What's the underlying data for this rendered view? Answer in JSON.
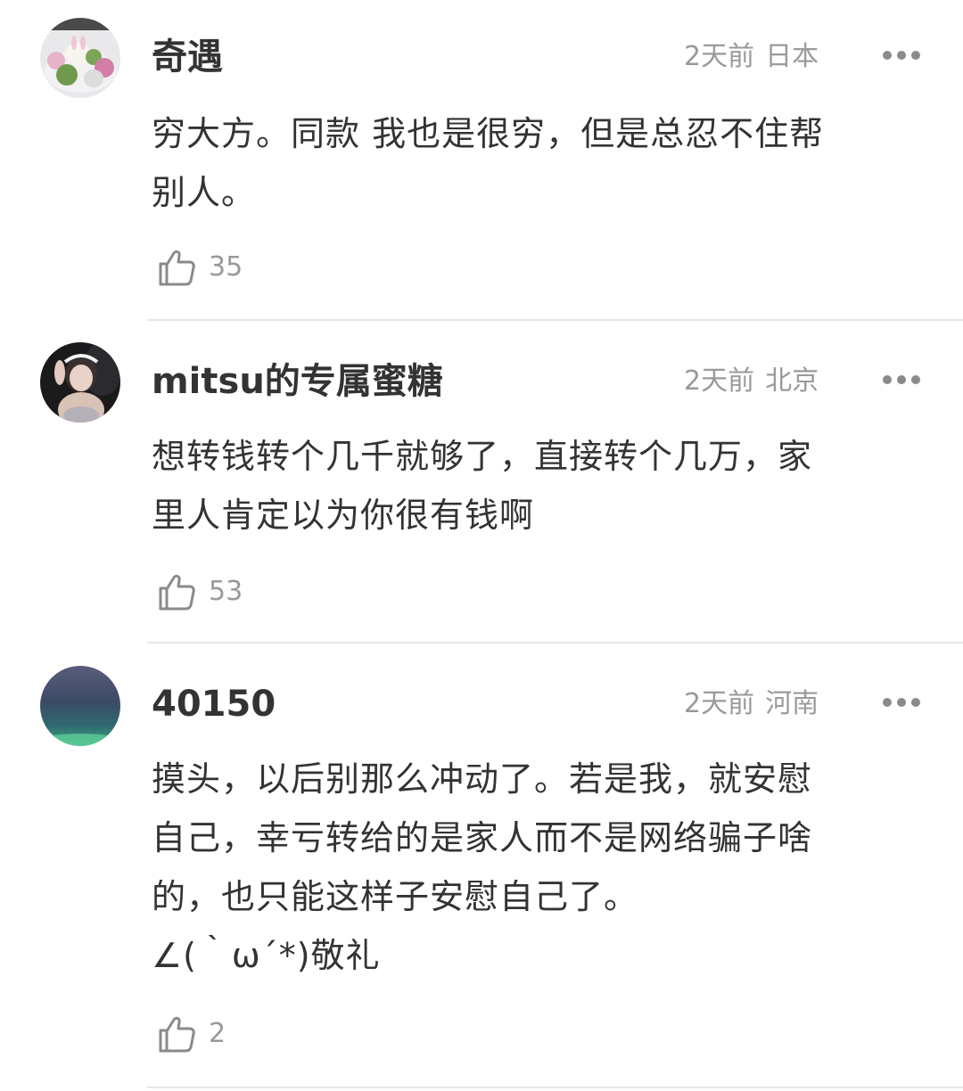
{
  "comments": [
    {
      "username": "奇遇",
      "time": "2天前",
      "location": "日本",
      "lines": [
        "穷大方。同款 我也是很穷，但是总忍不住帮",
        "别人。"
      ],
      "likes": "35",
      "avatar": "dessert-photo-avatar"
    },
    {
      "username": "mitsu的专属蜜糖",
      "time": "2天前",
      "location": "北京",
      "lines": [
        "想转钱转个几千就够了，直接转个几万，家",
        "里人肯定以为你很有钱啊"
      ],
      "likes": "53",
      "avatar": "portrait-photo-avatar"
    },
    {
      "username": "40150",
      "time": "2天前",
      "location": "河南",
      "lines": [
        "摸头，以后别那么冲动了。若是我，就安慰",
        "自己，幸亏转给的是家人而不是网络骗子啥",
        "的，也只能这样子安慰自己了。",
        "∠(｀ω´*)敬礼"
      ],
      "likes": "2",
      "avatar": "aurora-photo-avatar"
    }
  ],
  "icons": {
    "like": "thumbs-up-icon",
    "more": "more-dots-icon"
  },
  "colors": {
    "text": "#333333",
    "meta": "#9a9a9a",
    "divider": "#e6e6e6"
  }
}
